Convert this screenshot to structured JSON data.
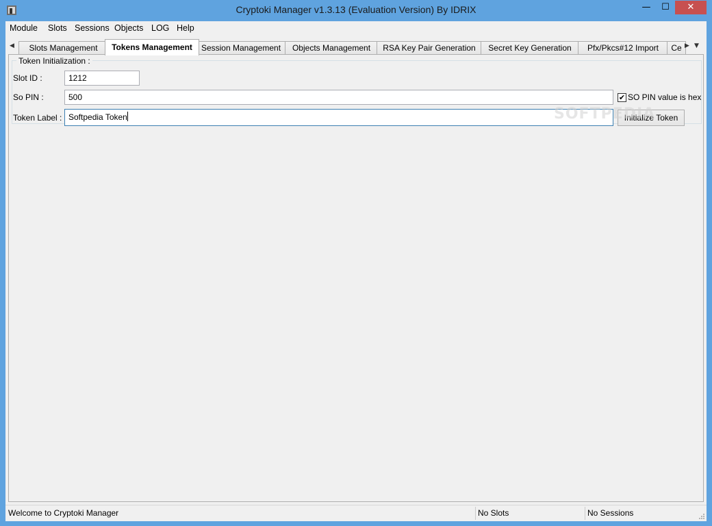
{
  "window": {
    "title": "Cryptoki Manager v1.3.13  (Evaluation Version)  By IDRIX",
    "controls": {
      "minimize": "—",
      "maximize": "☐",
      "close": "✕"
    }
  },
  "menu": {
    "items": [
      "Module",
      "Slots",
      "Sessions",
      "Objects",
      "LOG",
      "Help"
    ]
  },
  "tabs": {
    "items": [
      {
        "label": "Slots Management"
      },
      {
        "label": "Tokens Management",
        "active": true
      },
      {
        "label": "Session Management"
      },
      {
        "label": "Objects Management"
      },
      {
        "label": "RSA Key Pair Generation"
      },
      {
        "label": "Secret Key Generation"
      },
      {
        "label": "Pfx/Pkcs#12 Import"
      },
      {
        "label": "Ce"
      }
    ],
    "scroll_left": "◀",
    "scroll_right": "▶",
    "dropdown": "▼"
  },
  "token_init": {
    "group_title": "Token Initialization :",
    "slot_id": {
      "label": "Slot ID :",
      "value": "1212"
    },
    "so_pin": {
      "label": "So PIN :",
      "value": "500"
    },
    "so_pin_hex": {
      "label": "SO PIN value is hex",
      "checked": true,
      "check_glyph": "✔"
    },
    "token_label": {
      "label": "Token Label :",
      "value": "Softpedia Token"
    },
    "initialize_button": "Initialize Token"
  },
  "watermark": "SOFTPEDIA",
  "status": {
    "message": "Welcome to Cryptoki Manager",
    "slots": "No Slots",
    "sessions": "No Sessions"
  }
}
